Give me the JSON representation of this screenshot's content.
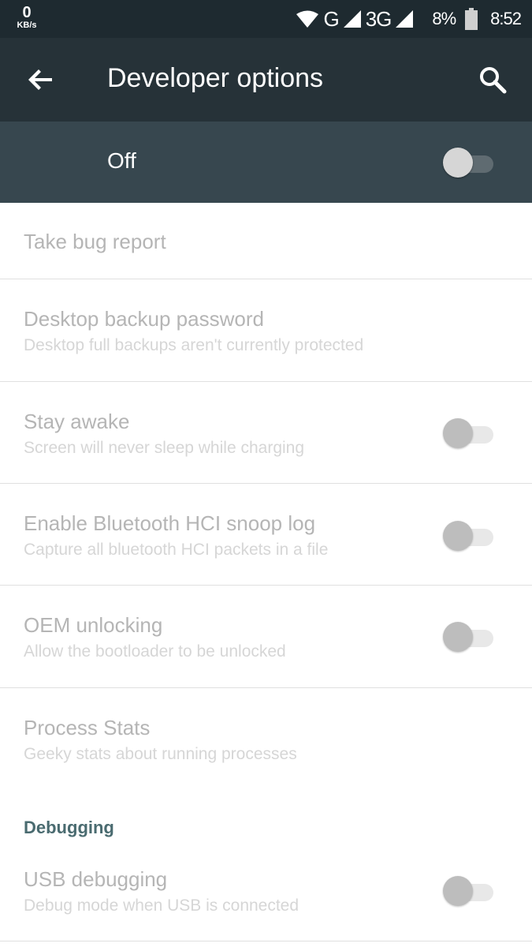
{
  "status_bar": {
    "speed_value": "0",
    "speed_unit": "KB/s",
    "network_1": "G",
    "network_2": "3G",
    "battery": "8%",
    "time": "8:52"
  },
  "app_bar": {
    "title": "Developer options",
    "back_icon": "arrow-left",
    "search_icon": "magnifier"
  },
  "master_switch": {
    "label": "Off",
    "state": "off"
  },
  "items": [
    {
      "title": "Take bug report",
      "subtitle": ""
    },
    {
      "title": "Desktop backup password",
      "subtitle": "Desktop full backups aren't currently protected"
    },
    {
      "title": "Stay awake",
      "subtitle": "Screen will never sleep while charging",
      "toggle": "off"
    },
    {
      "title": "Enable Bluetooth HCI snoop log",
      "subtitle": "Capture all bluetooth HCI packets in a file",
      "toggle": "off"
    },
    {
      "title": "OEM unlocking",
      "subtitle": "Allow the bootloader to be unlocked",
      "toggle": "off"
    },
    {
      "title": "Process Stats",
      "subtitle": "Geeky stats about running processes"
    }
  ],
  "sections": {
    "debugging": {
      "header": "Debugging",
      "items": [
        {
          "title": "USB debugging",
          "subtitle": "Debug mode when USB is connected",
          "toggle": "off"
        }
      ]
    }
  },
  "colors": {
    "status_bar": "#1e2a30",
    "app_bar": "#263238",
    "master_bar": "#37474f",
    "section_header": "#4a6b70",
    "disabled_text": "#b5b5b5"
  }
}
